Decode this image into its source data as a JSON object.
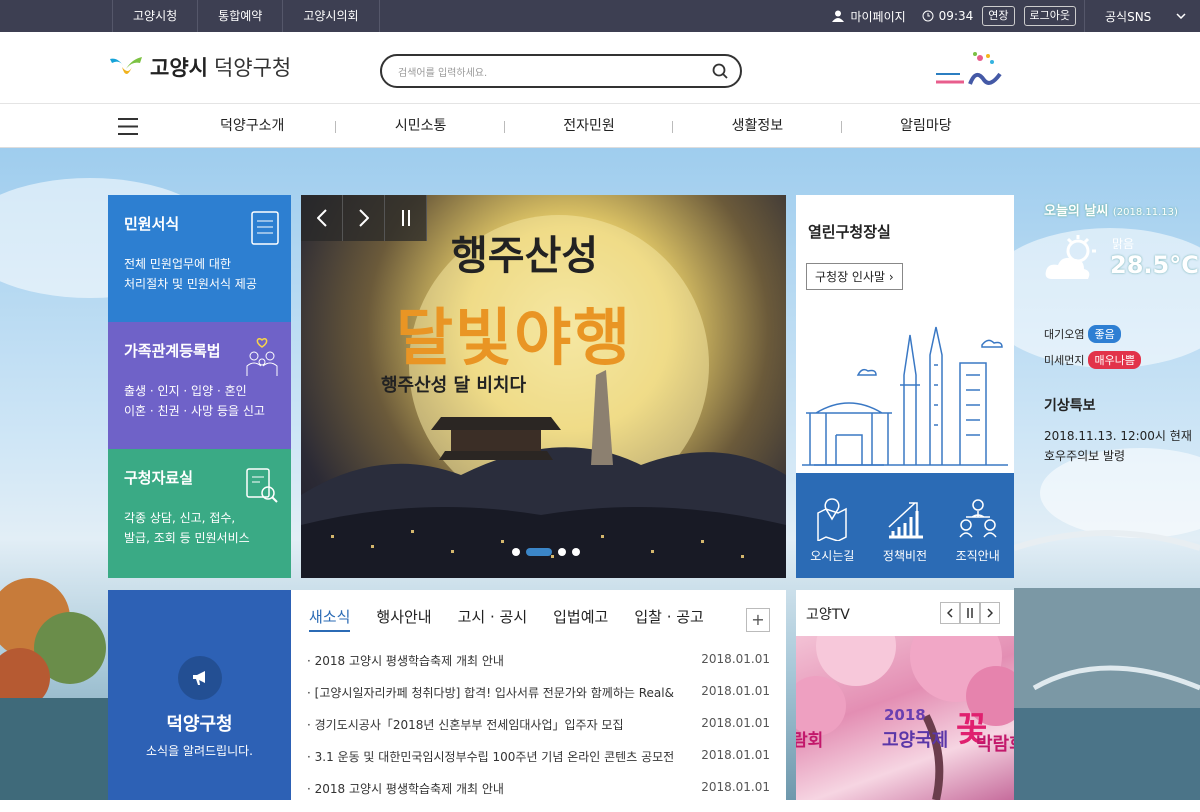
{
  "topbar": {
    "links": [
      "고양시청",
      "통합예약",
      "고양시의회"
    ],
    "mypage": "마이페이지",
    "time": "09:34",
    "extend": "연장",
    "logout": "로그아웃",
    "sns": "공식SNS"
  },
  "header": {
    "logo_city": "고양시",
    "logo_district": "덕양구청",
    "search_placeholder": "검색어를 입력하세요."
  },
  "gnb": {
    "items": [
      "덕양구소개",
      "시민소통",
      "전자민원",
      "생활정보",
      "알림마당"
    ]
  },
  "cards": [
    {
      "title": "민원서식",
      "desc1": "전체 민원업무에 대한",
      "desc2": "처리절차 및 민원서식 제공",
      "color": "#2d7fd1"
    },
    {
      "title": "가족관계등록법",
      "desc1": "출생 · 인지 · 입양 · 혼인",
      "desc2": "이혼 · 친권 · 사망 등을 신고",
      "color": "#6f62c8"
    },
    {
      "title": "구청자료실",
      "desc1": "각종 상담, 신고, 접수,",
      "desc2": "발급, 조회 등 민원서비스",
      "color": "#3aaa85"
    }
  ],
  "banner": {
    "title1": "행주산성",
    "title2": "달빛야행",
    "sub": "행주산성 달 비치다"
  },
  "mayor": {
    "title": "열린구청장실",
    "button": "구청장 인사말"
  },
  "quick": [
    "오시는길",
    "정책비전",
    "조직안내"
  ],
  "weather": {
    "title": "오늘의 날씨",
    "date": "(2018.11.13)",
    "status": "맑음",
    "temp": "28.5°C",
    "air_label": "대기오염",
    "air_value": "좋음",
    "dust_label": "미세먼지",
    "dust_value": "매우나쁨",
    "warn_title": "기상특보",
    "warn_line1": "2018.11.13. 12:00시 현재",
    "warn_line2": "호우주의보 발령"
  },
  "newsLeft": {
    "title": "덕양구청",
    "sub": "소식을 알려드립니다."
  },
  "news": {
    "tabs": [
      "새소식",
      "행사안내",
      "고시 · 공시",
      "입법예고",
      "입찰 · 공고"
    ],
    "items": [
      {
        "t": "2018 고양시 평생학습축제 개최 안내",
        "d": "2018.01.01"
      },
      {
        "t": "[고양시일자리카페 청취다방] 합격! 입사서류 전문가와 함께하는 Real&",
        "d": "2018.01.01"
      },
      {
        "t": "경기도시공사「2018년 신혼부부 전세임대사업」입주자 모집",
        "d": "2018.01.01"
      },
      {
        "t": "3.1 운동 및 대한민국임시정부수립 100주년 기념 온라인 콘텐츠 공모전",
        "d": "2018.01.01"
      },
      {
        "t": "2018 고양시 평생학습축제 개최 안내",
        "d": "2018.01.01"
      }
    ]
  },
  "tv": {
    "title": "고양TV",
    "poster1": "2018",
    "poster2": "고양국제",
    "poster3": "꽃",
    "poster4": "박람회",
    "poster_left": "람회"
  }
}
